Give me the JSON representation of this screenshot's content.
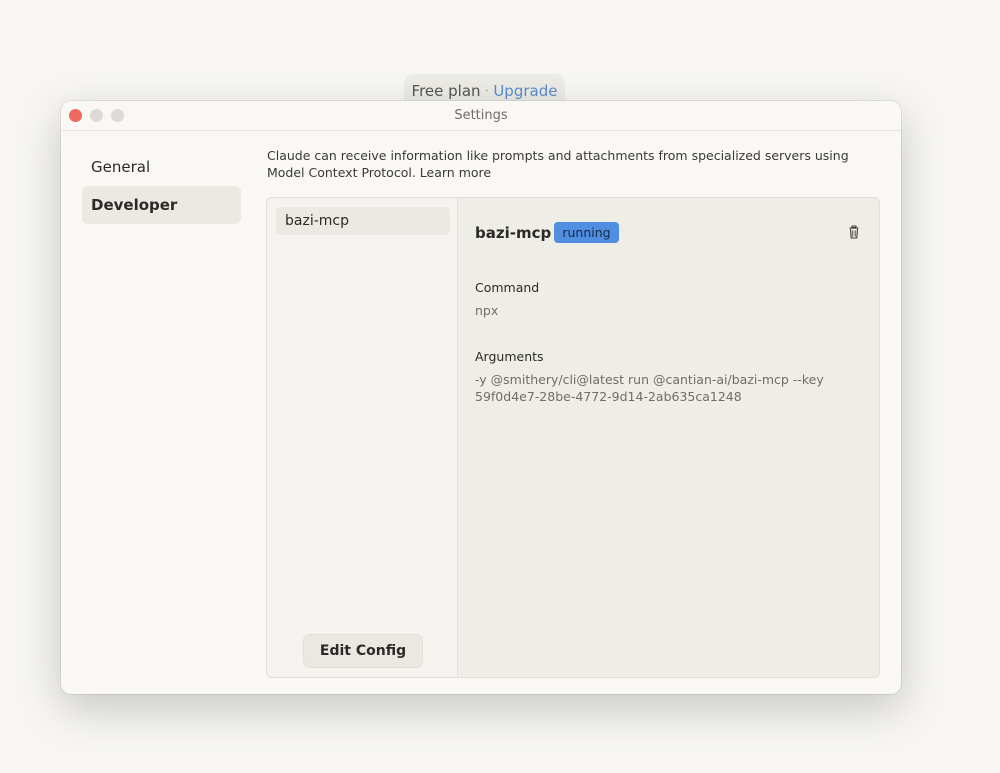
{
  "plan": {
    "label": "Free plan",
    "separator": "·",
    "upgrade": "Upgrade"
  },
  "window": {
    "title": "Settings"
  },
  "sidebar": {
    "items": [
      {
        "label": "General",
        "selected": false
      },
      {
        "label": "Developer",
        "selected": true
      }
    ]
  },
  "intro": {
    "text": "Claude can receive information like prompts and attachments from specialized servers using Model Context Protocol.",
    "link": "Learn more"
  },
  "servers": {
    "items": [
      {
        "name": "bazi-mcp",
        "selected": true
      }
    ],
    "edit_config_label": "Edit Config"
  },
  "detail": {
    "name": "bazi-mcp",
    "status": "running",
    "command_label": "Command",
    "command_value": "npx",
    "arguments_label": "Arguments",
    "arguments_line1": "-y @smithery/cli@latest run @cantian-ai/bazi-mcp --key",
    "arguments_line2": "59f0d4e7-28be-4772-9d14-2ab635ca1248",
    "delete_icon": "trash-icon"
  },
  "colors": {
    "status_badge": "#4f8ee0",
    "upgrade_link": "#5b8bd1",
    "close_light": "#ed6a5e"
  }
}
